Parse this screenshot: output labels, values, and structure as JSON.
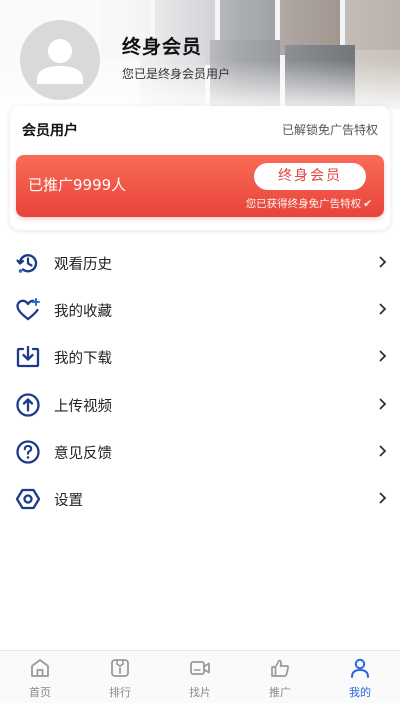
{
  "profile": {
    "name": "终身会员",
    "subtitle": "您已是终身会员用户"
  },
  "member_card": {
    "title": "会员用户",
    "privilege_note": "已解锁免广告特权",
    "promo_count": "已推广9999人",
    "lifetime_button": "终身会员",
    "promo_note": "您已获得终身免广告特权"
  },
  "menu": [
    {
      "label": "观看历史",
      "icon": "history-icon"
    },
    {
      "label": "我的收藏",
      "icon": "heart-star-icon"
    },
    {
      "label": "我的下载",
      "icon": "download-icon"
    },
    {
      "label": "上传视频",
      "icon": "upload-icon"
    },
    {
      "label": "意见反馈",
      "icon": "question-icon"
    },
    {
      "label": "设置",
      "icon": "settings-icon"
    }
  ],
  "tabs": [
    {
      "label": "首页",
      "icon": "home-icon",
      "active": false
    },
    {
      "label": "排行",
      "icon": "ranking-icon",
      "active": false
    },
    {
      "label": "找片",
      "icon": "video-camera-icon",
      "active": false
    },
    {
      "label": "推广",
      "icon": "thumbs-up-icon",
      "active": false
    },
    {
      "label": "我的",
      "icon": "user-icon",
      "active": true
    }
  ],
  "colors": {
    "accent_blue": "#2a67d8",
    "icon_navy": "#1e3a8a",
    "promo_red": "#e7443b",
    "promo_red_light": "#fa6b56"
  }
}
